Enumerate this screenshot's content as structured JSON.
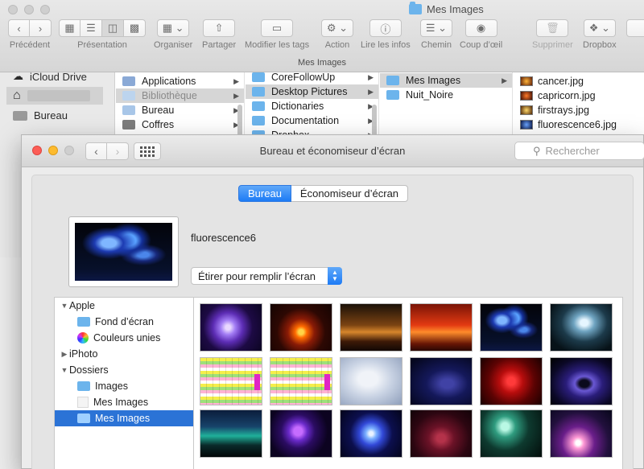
{
  "finder": {
    "title": "Mes Images",
    "path_label": "Mes Images",
    "toolbar": {
      "back_label": "Précédent",
      "presentation_label": "Présentation",
      "organize_label": "Organiser",
      "share_label": "Partager",
      "tags_label": "Modifier les tags",
      "action_label": "Action",
      "info_label": "Lire les infos",
      "path_button_label": "Chemin",
      "quicklook_label": "Coup d’œil",
      "delete_label": "Supprimer",
      "dropbox_label": "Dropbox"
    },
    "sidebar": {
      "items": [
        {
          "label": "iCloud Drive",
          "icon": "cloud-icon"
        },
        {
          "label": "",
          "icon": "home-icon"
        },
        {
          "label": "Bureau",
          "icon": "desktop-icon"
        }
      ]
    },
    "columns": {
      "col1": [
        "Applications",
        "Bibliothèque",
        "Bureau",
        "Coffres"
      ],
      "col2": [
        "CoreFollowUp",
        "Desktop Pictures",
        "Dictionaries",
        "Documentation",
        "Dropbox"
      ],
      "col3": [
        "Mes Images",
        "Nuit_Noire"
      ],
      "col4": [
        "cancer.jpg",
        "capricorn.jpg",
        "firstrays.jpg",
        "fluorescence6.jpg"
      ]
    }
  },
  "prefs": {
    "title": "Bureau et économiseur d’écran",
    "search_placeholder": "Rechercher",
    "tabs": {
      "desktop": "Bureau",
      "screensaver": "Économiseur d’écran"
    },
    "wallpaper_name": "fluorescence6",
    "fit_option": "Étirer pour remplir l’écran",
    "sources": {
      "apple": "Apple",
      "fond": "Fond d’écran",
      "couleurs": "Couleurs unies",
      "iphoto": "iPhoto",
      "dossiers": "Dossiers",
      "images": "Images",
      "mes_images_1": "Mes Images",
      "mes_images_2": "Mes Images"
    }
  }
}
